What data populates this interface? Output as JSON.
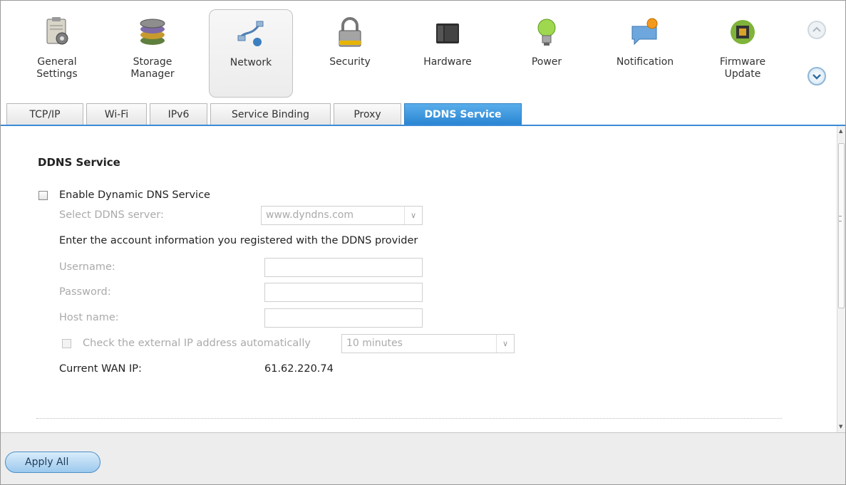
{
  "categories": [
    {
      "label": "General\nSettings",
      "icon": "clipboard-gear-icon"
    },
    {
      "label": "Storage\nManager",
      "icon": "storage-disks-icon"
    },
    {
      "label": "Network",
      "icon": "network-cable-icon"
    },
    {
      "label": "Security",
      "icon": "padlock-icon"
    },
    {
      "label": "Hardware",
      "icon": "nas-device-icon"
    },
    {
      "label": "Power",
      "icon": "lightbulb-icon"
    },
    {
      "label": "Notification",
      "icon": "speech-bubble-icon"
    },
    {
      "label": "Firmware\nUpdate",
      "icon": "chip-update-icon"
    }
  ],
  "tabs": [
    "TCP/IP",
    "Wi-Fi",
    "IPv6",
    "Service Binding",
    "Proxy",
    "DDNS Service"
  ],
  "active_tab": "DDNS Service",
  "section": {
    "title": "DDNS Service",
    "enable_label": "Enable Dynamic DNS Service",
    "enable_checked": false,
    "server_label": "Select DDNS server:",
    "server_value": "www.dyndns.com",
    "info_text": "Enter the account information you registered with the DDNS provider",
    "username_label": "Username:",
    "username_value": "",
    "password_label": "Password:",
    "password_value": "",
    "host_label": "Host name:",
    "host_value": "",
    "check_label": "Check the external IP address automatically",
    "check_checked": false,
    "interval_value": "10 minutes",
    "wan_label": "Current WAN IP:",
    "wan_value": "61.62.220.74"
  },
  "footer": {
    "apply_label": "Apply All"
  },
  "colors": {
    "accent": "#2a86d3",
    "tab_active_text": "#ffffff",
    "disabled_text": "#aaaaaa"
  }
}
